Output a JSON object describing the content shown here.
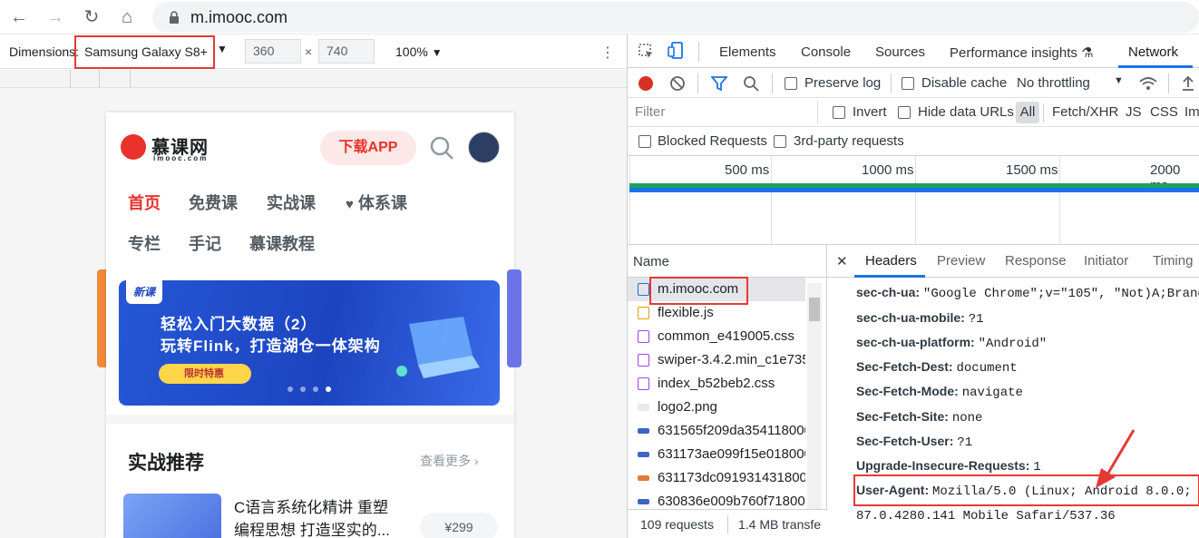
{
  "browser": {
    "url": "m.imooc.com"
  },
  "device_toolbar": {
    "dimensions_label": "Dimensions:",
    "device": "Samsung Galaxy S8+",
    "width": "360",
    "times": "×",
    "height": "740",
    "zoom": "100%",
    "caret": "▼"
  },
  "mobile_page": {
    "logo_text": "慕课网",
    "logo_sub": "imooc.com",
    "download_btn": "下载APP",
    "nav_row1": [
      "首页",
      "免费课",
      "实战课",
      "体系课"
    ],
    "nav_row2": [
      "专栏",
      "手记",
      "慕课教程"
    ],
    "banner": {
      "tag": "新课",
      "line1": "轻松入门大数据（2）",
      "line2": "玩转Flink，打造湖仓一体架构",
      "promo": "限时特惠"
    },
    "section_title": "实战推荐",
    "more": "查看更多",
    "course_line1": "C语言系统化精讲 重塑",
    "course_line2": "编程思想 打造坚实的...",
    "price": "¥299"
  },
  "devtools": {
    "tabs": [
      "Elements",
      "Console",
      "Sources",
      "Performance insights",
      "Network"
    ],
    "active_tab": "Network",
    "preserve_log": "Preserve log",
    "disable_cache": "Disable cache",
    "throttling": "No throttling",
    "filter_placeholder": "Filter",
    "invert": "Invert",
    "hide_data_urls": "Hide data URLs",
    "type_filters": [
      "All",
      "Fetch/XHR",
      "JS",
      "CSS",
      "Im"
    ],
    "blocked_requests": "Blocked Requests",
    "third_party": "3rd-party requests",
    "timeline_labels": [
      "500 ms",
      "1000 ms",
      "1500 ms",
      "2000 ms"
    ],
    "name_header": "Name",
    "requests": [
      {
        "name": "m.imooc.com",
        "icon": "document-icon"
      },
      {
        "name": "flexible.js",
        "icon": "script-icon"
      },
      {
        "name": "common_e419005.css",
        "icon": "stylesheet-icon"
      },
      {
        "name": "swiper-3.4.2.min_c1e735.",
        "icon": "stylesheet-icon"
      },
      {
        "name": "index_b52beb2.css",
        "icon": "stylesheet-icon"
      },
      {
        "name": "logo2.png",
        "icon": "image-icon"
      },
      {
        "name": "631565f209da354118000",
        "icon": "image-icon"
      },
      {
        "name": "631173ae099f15e018000",
        "icon": "image-icon"
      },
      {
        "name": "631173dc091931431800.",
        "icon": "image-icon"
      },
      {
        "name": "630836e009b760f718000",
        "icon": "image-icon"
      }
    ],
    "requests_count": "109 requests",
    "transferred": "1.4 MB transfe",
    "detail_tabs": [
      "Headers",
      "Preview",
      "Response",
      "Initiator",
      "Timing"
    ],
    "active_detail_tab": "Headers",
    "headers": [
      {
        "k": "sec-ch-ua:",
        "v": "\"Google Chrome\";v=\"105\", \"Not)A;Brand"
      },
      {
        "k": "sec-ch-ua-mobile:",
        "v": "?1"
      },
      {
        "k": "sec-ch-ua-platform:",
        "v": "\"Android\""
      },
      {
        "k": "Sec-Fetch-Dest:",
        "v": "document"
      },
      {
        "k": "Sec-Fetch-Mode:",
        "v": "navigate"
      },
      {
        "k": "Sec-Fetch-Site:",
        "v": "none"
      },
      {
        "k": "Sec-Fetch-User:",
        "v": "?1"
      },
      {
        "k": "Upgrade-Insecure-Requests:",
        "v": "1"
      },
      {
        "k": "User-Agent:",
        "v": "Mozilla/5.0 (Linux; Android 8.0.0;"
      }
    ],
    "ua_continuation": "87.0.4280.141 Mobile Safari/537.36"
  },
  "colors": {
    "accent_red": "#e53935",
    "brand_red": "#e8322b",
    "devtools_blue": "#1a73e8"
  }
}
